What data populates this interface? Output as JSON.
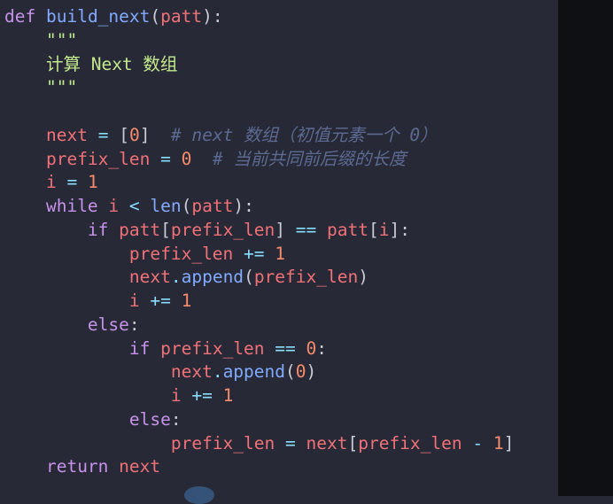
{
  "editor": {
    "lines": [
      [
        {
          "t": "def",
          "c": "kw"
        },
        {
          "t": " ",
          "c": "plain"
        },
        {
          "t": "build_next",
          "c": "fn"
        },
        {
          "t": "(",
          "c": "punc"
        },
        {
          "t": "patt",
          "c": "var"
        },
        {
          "t": "):",
          "c": "punc"
        }
      ],
      [
        {
          "t": "    ",
          "c": "plain"
        },
        {
          "t": "\"\"\"",
          "c": "str"
        }
      ],
      [
        {
          "t": "    ",
          "c": "plain"
        },
        {
          "t": "计算 Next 数组",
          "c": "str"
        }
      ],
      [
        {
          "t": "    ",
          "c": "plain"
        },
        {
          "t": "\"\"\"",
          "c": "str"
        }
      ],
      [],
      [
        {
          "t": "    ",
          "c": "plain"
        },
        {
          "t": "next",
          "c": "var"
        },
        {
          "t": " ",
          "c": "plain"
        },
        {
          "t": "=",
          "c": "op"
        },
        {
          "t": " ",
          "c": "plain"
        },
        {
          "t": "[",
          "c": "punc"
        },
        {
          "t": "0",
          "c": "num"
        },
        {
          "t": "]",
          "c": "punc"
        },
        {
          "t": "  ",
          "c": "plain"
        },
        {
          "t": "# next 数组（初值元素一个 0）",
          "c": "cmt"
        }
      ],
      [
        {
          "t": "    ",
          "c": "plain"
        },
        {
          "t": "prefix_len",
          "c": "var"
        },
        {
          "t": " ",
          "c": "plain"
        },
        {
          "t": "=",
          "c": "op"
        },
        {
          "t": " ",
          "c": "plain"
        },
        {
          "t": "0",
          "c": "num"
        },
        {
          "t": "  ",
          "c": "plain"
        },
        {
          "t": "# 当前共同前后缀的长度",
          "c": "cmt"
        }
      ],
      [
        {
          "t": "    ",
          "c": "plain"
        },
        {
          "t": "i",
          "c": "var"
        },
        {
          "t": " ",
          "c": "plain"
        },
        {
          "t": "=",
          "c": "op"
        },
        {
          "t": " ",
          "c": "plain"
        },
        {
          "t": "1",
          "c": "num"
        }
      ],
      [
        {
          "t": "    ",
          "c": "plain"
        },
        {
          "t": "while",
          "c": "kw"
        },
        {
          "t": " ",
          "c": "plain"
        },
        {
          "t": "i",
          "c": "var"
        },
        {
          "t": " ",
          "c": "plain"
        },
        {
          "t": "<",
          "c": "op"
        },
        {
          "t": " ",
          "c": "plain"
        },
        {
          "t": "len",
          "c": "fn"
        },
        {
          "t": "(",
          "c": "punc"
        },
        {
          "t": "patt",
          "c": "var"
        },
        {
          "t": "):",
          "c": "punc"
        }
      ],
      [
        {
          "t": "        ",
          "c": "plain"
        },
        {
          "t": "if",
          "c": "kw"
        },
        {
          "t": " ",
          "c": "plain"
        },
        {
          "t": "patt",
          "c": "var"
        },
        {
          "t": "[",
          "c": "punc"
        },
        {
          "t": "prefix_len",
          "c": "var"
        },
        {
          "t": "]",
          "c": "punc"
        },
        {
          "t": " ",
          "c": "plain"
        },
        {
          "t": "==",
          "c": "op"
        },
        {
          "t": " ",
          "c": "plain"
        },
        {
          "t": "patt",
          "c": "var"
        },
        {
          "t": "[",
          "c": "punc"
        },
        {
          "t": "i",
          "c": "var"
        },
        {
          "t": "]:",
          "c": "punc"
        }
      ],
      [
        {
          "t": "            ",
          "c": "plain"
        },
        {
          "t": "prefix_len",
          "c": "var"
        },
        {
          "t": " ",
          "c": "plain"
        },
        {
          "t": "+=",
          "c": "op"
        },
        {
          "t": " ",
          "c": "plain"
        },
        {
          "t": "1",
          "c": "num"
        }
      ],
      [
        {
          "t": "            ",
          "c": "plain"
        },
        {
          "t": "next",
          "c": "var"
        },
        {
          "t": ".",
          "c": "op"
        },
        {
          "t": "append",
          "c": "fn"
        },
        {
          "t": "(",
          "c": "punc"
        },
        {
          "t": "prefix_len",
          "c": "var"
        },
        {
          "t": ")",
          "c": "punc"
        }
      ],
      [
        {
          "t": "            ",
          "c": "plain"
        },
        {
          "t": "i",
          "c": "var"
        },
        {
          "t": " ",
          "c": "plain"
        },
        {
          "t": "+=",
          "c": "op"
        },
        {
          "t": " ",
          "c": "plain"
        },
        {
          "t": "1",
          "c": "num"
        }
      ],
      [
        {
          "t": "        ",
          "c": "plain"
        },
        {
          "t": "else",
          "c": "kw"
        },
        {
          "t": ":",
          "c": "punc"
        }
      ],
      [
        {
          "t": "            ",
          "c": "plain"
        },
        {
          "t": "if",
          "c": "kw"
        },
        {
          "t": " ",
          "c": "plain"
        },
        {
          "t": "prefix_len",
          "c": "var"
        },
        {
          "t": " ",
          "c": "plain"
        },
        {
          "t": "==",
          "c": "op"
        },
        {
          "t": " ",
          "c": "plain"
        },
        {
          "t": "0",
          "c": "num"
        },
        {
          "t": ":",
          "c": "punc"
        }
      ],
      [
        {
          "t": "                ",
          "c": "plain"
        },
        {
          "t": "next",
          "c": "var"
        },
        {
          "t": ".",
          "c": "op"
        },
        {
          "t": "append",
          "c": "fn"
        },
        {
          "t": "(",
          "c": "punc"
        },
        {
          "t": "0",
          "c": "num"
        },
        {
          "t": ")",
          "c": "punc"
        }
      ],
      [
        {
          "t": "                ",
          "c": "plain"
        },
        {
          "t": "i",
          "c": "var"
        },
        {
          "t": " ",
          "c": "plain"
        },
        {
          "t": "+=",
          "c": "op"
        },
        {
          "t": " ",
          "c": "plain"
        },
        {
          "t": "1",
          "c": "num"
        }
      ],
      [
        {
          "t": "            ",
          "c": "plain"
        },
        {
          "t": "else",
          "c": "kw"
        },
        {
          "t": ":",
          "c": "punc"
        }
      ],
      [
        {
          "t": "                ",
          "c": "plain"
        },
        {
          "t": "prefix_len",
          "c": "var"
        },
        {
          "t": " ",
          "c": "plain"
        },
        {
          "t": "=",
          "c": "op"
        },
        {
          "t": " ",
          "c": "plain"
        },
        {
          "t": "next",
          "c": "var"
        },
        {
          "t": "[",
          "c": "punc"
        },
        {
          "t": "prefix_len",
          "c": "var"
        },
        {
          "t": " ",
          "c": "plain"
        },
        {
          "t": "-",
          "c": "op"
        },
        {
          "t": " ",
          "c": "plain"
        },
        {
          "t": "1",
          "c": "num"
        },
        {
          "t": "]",
          "c": "punc"
        }
      ],
      [
        {
          "t": "    ",
          "c": "plain"
        },
        {
          "t": "return",
          "c": "kw"
        },
        {
          "t": " ",
          "c": "plain"
        },
        {
          "t": "next",
          "c": "var"
        }
      ]
    ]
  },
  "colors": {
    "background": "#272a36",
    "right_panel": "#0f1014",
    "keyword": "#c792ea",
    "function": "#82aaff",
    "variable": "#f07178",
    "number": "#f78c6c",
    "operator": "#89ddff",
    "string": "#c3e88d",
    "comment": "#5c6a92"
  }
}
